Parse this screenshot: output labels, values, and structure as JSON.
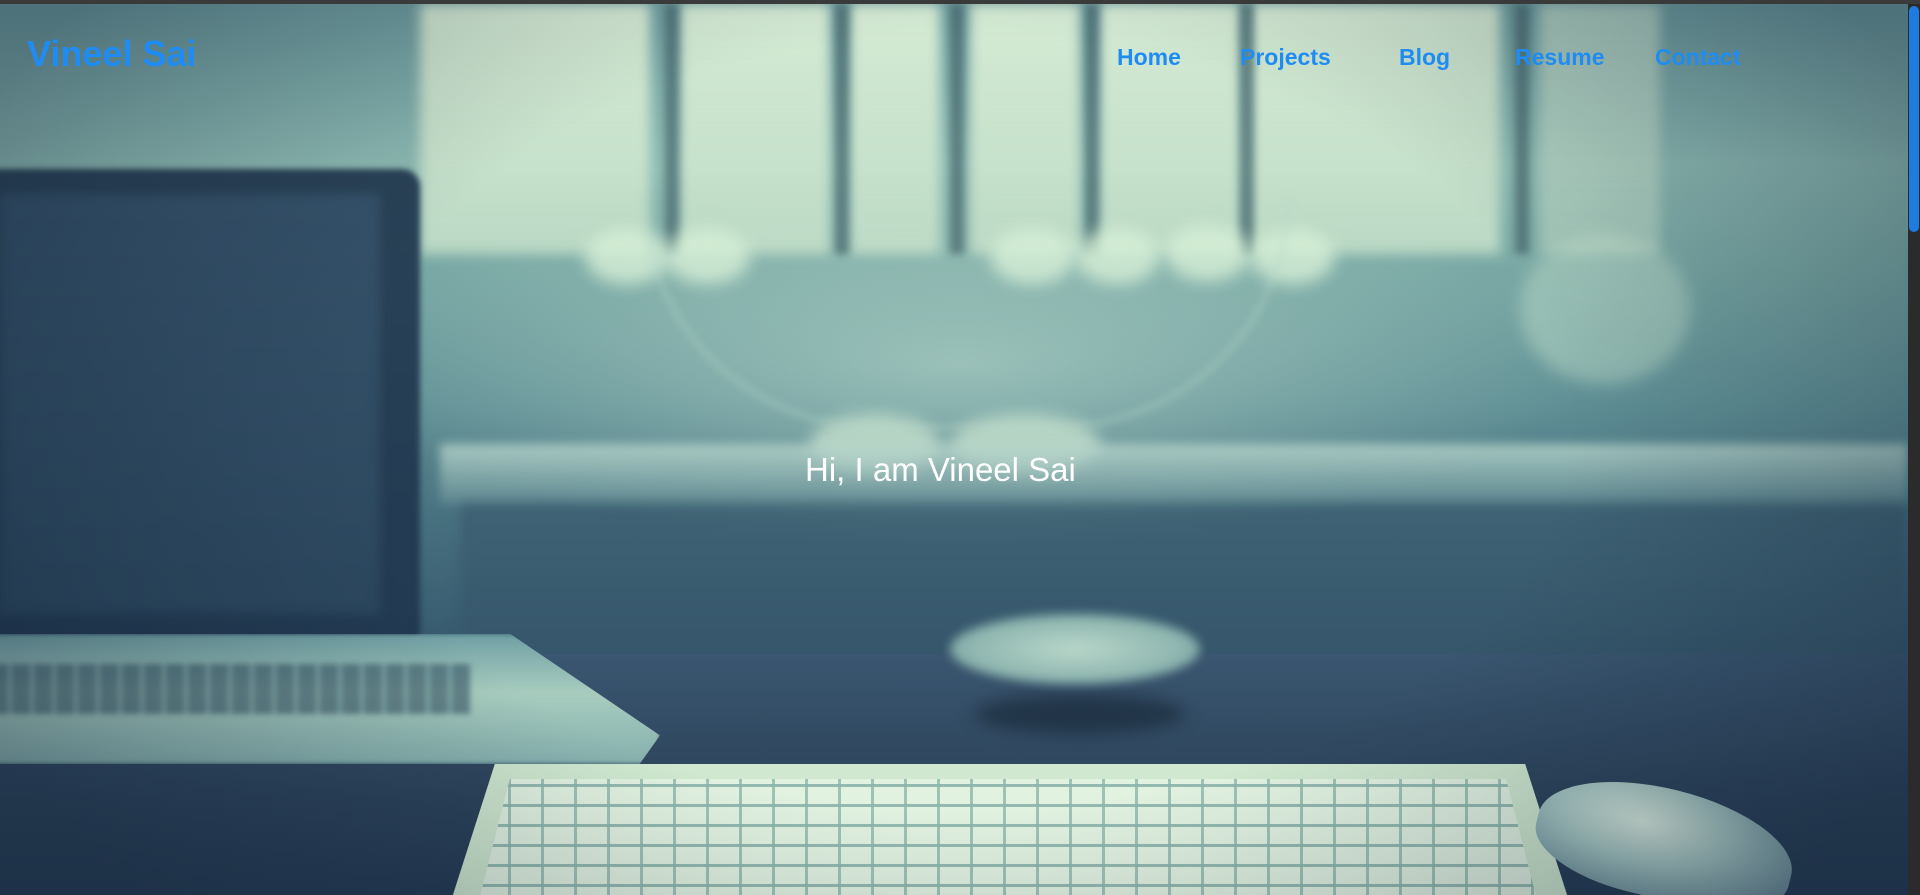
{
  "site": {
    "brand": "Vineel Sai"
  },
  "nav": {
    "items": [
      {
        "label": "Home"
      },
      {
        "label": "Projects"
      },
      {
        "label": "Blog"
      },
      {
        "label": "Resume"
      },
      {
        "label": "Contact"
      }
    ]
  },
  "hero": {
    "heading": "Hi, I am Vineel Sai",
    "background_image": "blurred desk workspace with laptop, keyboard and mouse"
  },
  "colors": {
    "accent": "#1e8cf2",
    "hero_text": "#ffffff",
    "scroll_thumb": "#1e7be0"
  }
}
